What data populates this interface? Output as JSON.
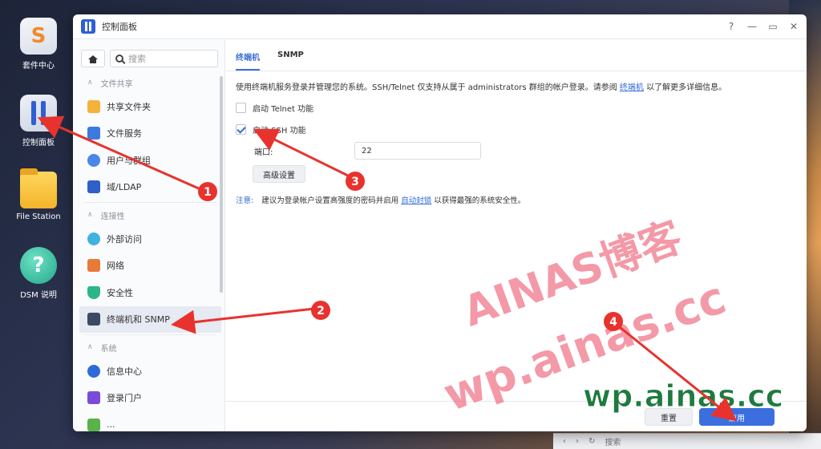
{
  "desktop": {
    "icons": [
      {
        "label": "套件中心",
        "icon": "package-center-icon"
      },
      {
        "label": "控制面板",
        "icon": "control-panel-icon"
      },
      {
        "label": "File Station",
        "icon": "folder-icon"
      },
      {
        "label": "DSM 说明",
        "icon": "help-icon"
      }
    ]
  },
  "window": {
    "title": "控制面板",
    "controls": {
      "help": "?",
      "minimize": "—",
      "maximize": "▭",
      "close": "✕"
    }
  },
  "sidebar": {
    "search_placeholder": "搜索",
    "groups": [
      {
        "title": "文件共享",
        "items": [
          "共享文件夹",
          "文件服务",
          "用户与群组",
          "域/LDAP"
        ]
      },
      {
        "title": "连接性",
        "items": [
          "外部访问",
          "网络",
          "安全性",
          "终端机和 SNMP"
        ]
      },
      {
        "title": "系统",
        "items": [
          "信息中心",
          "登录门户",
          "..."
        ]
      }
    ],
    "active_item": "终端机和 SNMP"
  },
  "tabs": [
    "终端机",
    "SNMP"
  ],
  "panel": {
    "description_prefix": "使用终端机服务登录并管理您的系统。SSH/Telnet 仅支持从属于 administrators 群组的帐户登录。请参阅 ",
    "description_link": "终端机",
    "description_suffix": " 以了解更多详细信息。",
    "telnet_label": "启动 Telnet 功能",
    "telnet_checked": false,
    "ssh_label": "启动 SSH 功能",
    "ssh_checked": true,
    "port_label": "端口:",
    "port_value": "22",
    "advanced_button": "高级设置",
    "note_label": "注意:",
    "note_prefix": "建议为登录帐户设置高强度的密码并启用 ",
    "note_link": "自动封锁",
    "note_suffix": " 以获得最强的系统安全性。"
  },
  "footer": {
    "reset": "重置",
    "apply": "应用"
  },
  "background_window": {
    "search_placeholder": "搜索"
  },
  "annotations": {
    "steps": [
      "1",
      "2",
      "3",
      "4"
    ],
    "watermark_1": "AINAS博客",
    "watermark_2": "wp.ainas.cc",
    "site_label": "wp.ainas.cc",
    "color_arrow": "#e8322e"
  },
  "colors": {
    "accent": "#3b6fd8",
    "active_item_bg": "#e6eaf2",
    "apply_button": "#3b6fe0"
  }
}
